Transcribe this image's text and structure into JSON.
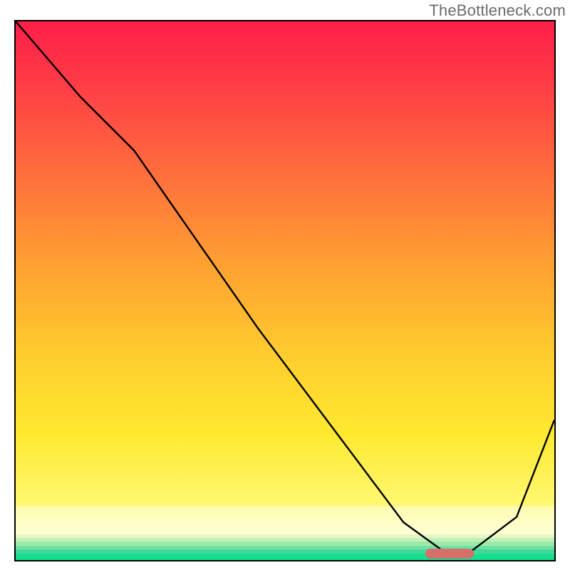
{
  "watermark": "TheBottleneck.com",
  "chart_data": {
    "type": "line",
    "title": "",
    "xlabel": "",
    "ylabel": "",
    "xlim": [
      0,
      100
    ],
    "ylim": [
      0,
      100
    ],
    "grid": false,
    "background": "vertical gradient red→orange→yellow→pale→green stripes",
    "series": [
      {
        "name": "bottleneck-curve",
        "x": [
          0,
          12,
          22,
          45,
          60,
          72,
          80,
          84,
          93,
          100
        ],
        "y": [
          100,
          86,
          76,
          43,
          23,
          7,
          1.2,
          1.2,
          8,
          26
        ],
        "stroke": "#000000"
      }
    ],
    "marker": {
      "name": "optimal-range",
      "x_start": 76,
      "x_end": 85,
      "y": 1.2,
      "color": "#d66e6c"
    },
    "gradient_stops": [
      {
        "pos": 0,
        "color": "#ff1f49"
      },
      {
        "pos": 30,
        "color": "#ff6a3d"
      },
      {
        "pos": 60,
        "color": "#ffcf2e"
      },
      {
        "pos": 88,
        "color": "#fff873"
      },
      {
        "pos": 94,
        "color": "#ffffd8"
      },
      {
        "pos": 100,
        "color": "#12e08e"
      }
    ]
  }
}
